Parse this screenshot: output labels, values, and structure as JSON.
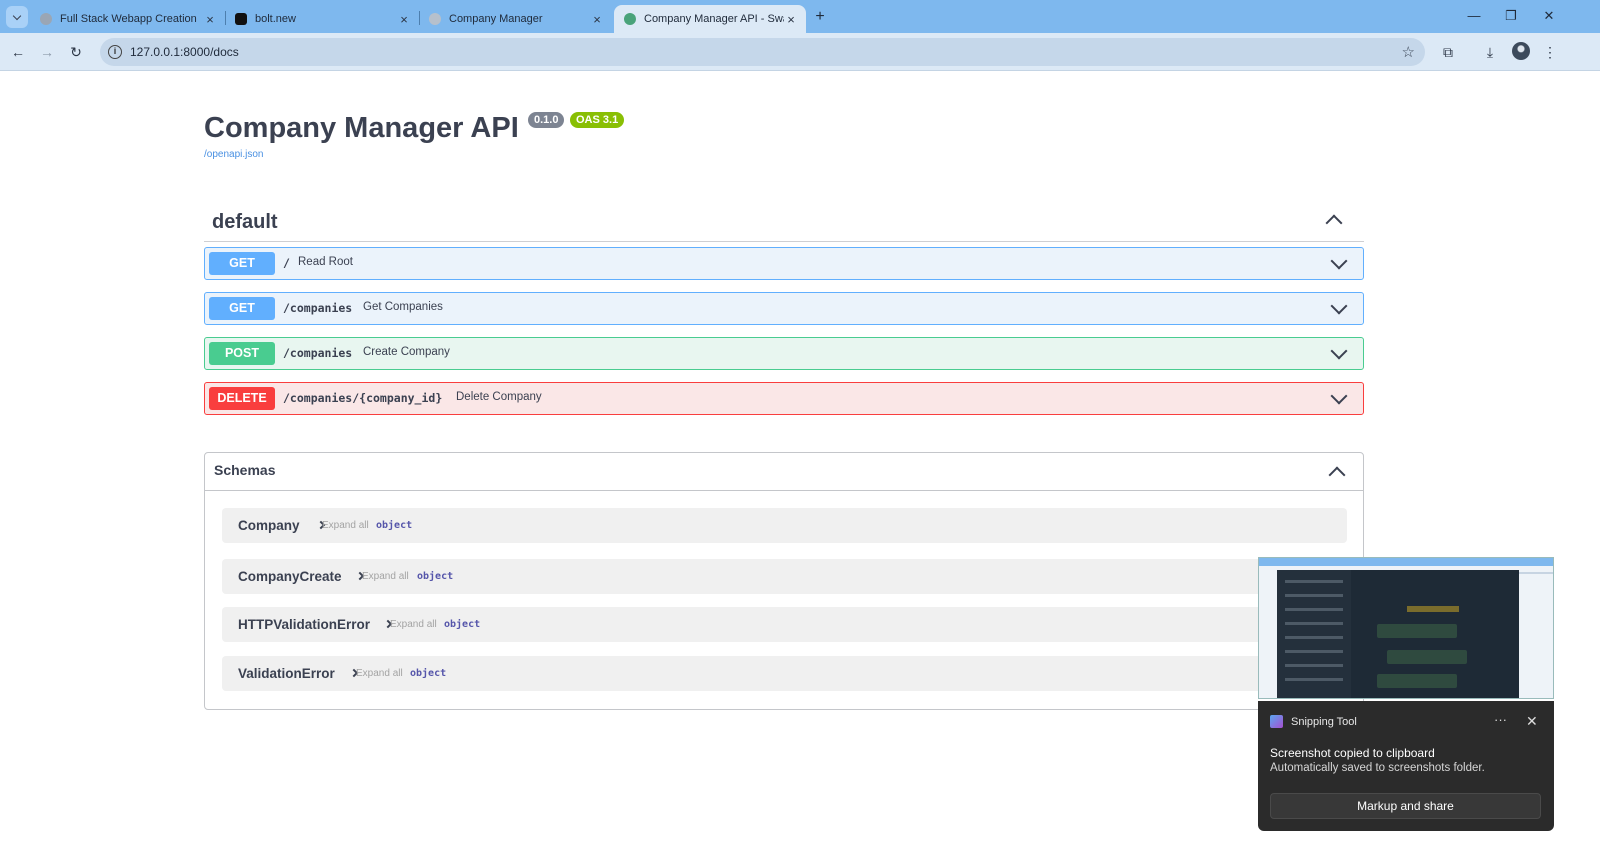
{
  "browser": {
    "tabs": [
      {
        "title": "Full Stack Webapp Creation"
      },
      {
        "title": "bolt.new"
      },
      {
        "title": "Company Manager"
      },
      {
        "title": "Company Manager API - Swagger UI"
      }
    ],
    "new_tab": "+",
    "close_glyph": "×",
    "url": "127.0.0.1:8000/docs",
    "window_controls": {
      "minimize": "—",
      "maximize": "❐",
      "close": "✕"
    }
  },
  "api": {
    "title": "Company Manager API",
    "version": "0.1.0",
    "oas": "OAS 3.1",
    "spec_link": "/openapi.json"
  },
  "section": {
    "name": "default"
  },
  "operations": [
    {
      "method": "GET",
      "path": "/",
      "summary": "Read Root"
    },
    {
      "method": "GET",
      "path": "/companies",
      "summary": "Get Companies"
    },
    {
      "method": "POST",
      "path": "/companies",
      "summary": "Create Company"
    },
    {
      "method": "DELETE",
      "path": "/companies/{company_id}",
      "summary": "Delete Company"
    }
  ],
  "schemas": {
    "title": "Schemas",
    "models": [
      {
        "name": "Company",
        "expand": "Expand all",
        "type": "object"
      },
      {
        "name": "CompanyCreate",
        "expand": "Expand all",
        "type": "object"
      },
      {
        "name": "HTTPValidationError",
        "expand": "Expand all",
        "type": "object"
      },
      {
        "name": "ValidationError",
        "expand": "Expand all",
        "type": "object"
      }
    ]
  },
  "snipping_tool": {
    "app": "Snipping Tool",
    "more": "···",
    "close": "✕",
    "message": "Screenshot copied to clipboard",
    "detail": "Automatically saved to screenshots folder.",
    "action": "Markup and share"
  },
  "colors": {
    "get": "#61affe",
    "post": "#49cc90",
    "delete": "#f93e3e",
    "oas_badge": "#89bf04",
    "version_badge": "#7d8492"
  }
}
